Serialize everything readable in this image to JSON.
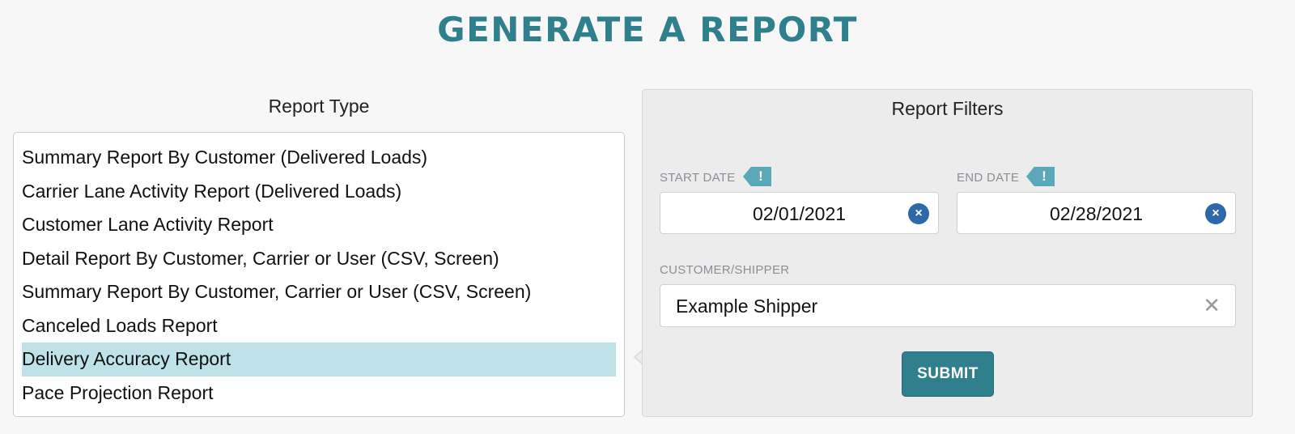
{
  "page": {
    "title": "GENERATE A REPORT"
  },
  "report_type": {
    "heading": "Report Type",
    "items": [
      "Summary Report By Customer (Delivered Loads)",
      "Carrier Lane Activity Report (Delivered Loads)",
      "Customer Lane Activity Report",
      "Detail Report By Customer, Carrier or User (CSV, Screen)",
      "Summary Report By Customer, Carrier or User (CSV, Screen)",
      "Canceled Loads Report",
      "Delivery Accuracy Report",
      "Pace Projection Report"
    ],
    "selected": "Delivery Accuracy Report"
  },
  "filters": {
    "heading": "Report Filters",
    "start_date": {
      "label": "START DATE",
      "required_mark": "!",
      "value": "02/01/2021",
      "clear_icon": "×"
    },
    "end_date": {
      "label": "END DATE",
      "required_mark": "!",
      "value": "02/28/2021",
      "clear_icon": "×"
    },
    "customer": {
      "label": "CUSTOMER/SHIPPER",
      "value": "Example Shipper",
      "clear_icon": "✕"
    },
    "submit_label": "SUBMIT"
  },
  "colors": {
    "accent": "#2f7f8d",
    "selected_row": "#bfe1e8",
    "required_tag": "#5aa8b8",
    "clear_button": "#2d68a8"
  }
}
